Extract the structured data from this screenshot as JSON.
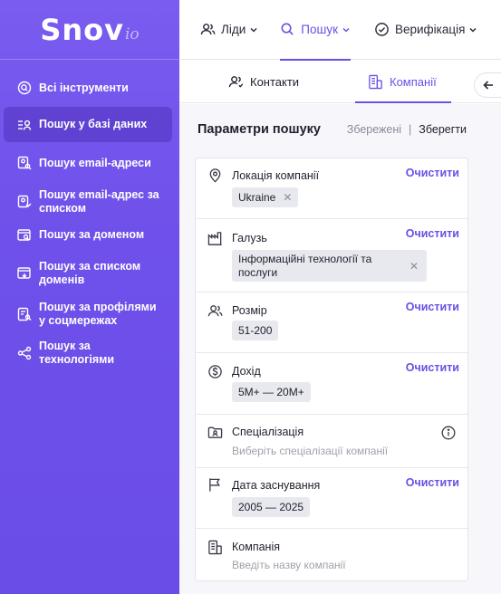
{
  "logo": {
    "main": "Snov",
    "sub": "io"
  },
  "sidebar": {
    "items": [
      {
        "label": "Всі інструменти"
      },
      {
        "label": "Пошук у базі даних"
      },
      {
        "label": "Пошук email-адреси"
      },
      {
        "label": "Пошук email-адрес за списком"
      },
      {
        "label": "Пошук за доменом"
      },
      {
        "label": "Пошук за списком доменів"
      },
      {
        "label": "Пошук за профілями у соцмережах"
      },
      {
        "label": "Пошук за технологіями"
      }
    ]
  },
  "topnav": {
    "items": [
      {
        "label": "Ліди"
      },
      {
        "label": "Пошук"
      },
      {
        "label": "Верифікація"
      }
    ]
  },
  "subtabs": {
    "contacts": "Контакти",
    "companies": "Компанії"
  },
  "params": {
    "title": "Параметри пошуку",
    "saved": "Збережені",
    "separator": "|",
    "save": "Зберегти"
  },
  "filters": {
    "clear_label": "Очистити",
    "location": {
      "label": "Локація компанії",
      "chip": "Ukraine"
    },
    "industry": {
      "label": "Галузь",
      "chip": "Інформаційні технології та послуги"
    },
    "size": {
      "label": "Розмір",
      "chip": "51-200"
    },
    "revenue": {
      "label": "Дохід",
      "chip": "5M+ — 20M+"
    },
    "specialization": {
      "label": "Спеціалізація",
      "placeholder": "Виберіть спеціалізації компанії"
    },
    "founded": {
      "label": "Дата заснування",
      "chip": "2005 — 2025"
    },
    "company": {
      "label": "Компанія",
      "placeholder": "Введіть назву компанії"
    }
  },
  "colors": {
    "accent": "#6a4fe6",
    "sidebar": "#7a5cf0"
  }
}
